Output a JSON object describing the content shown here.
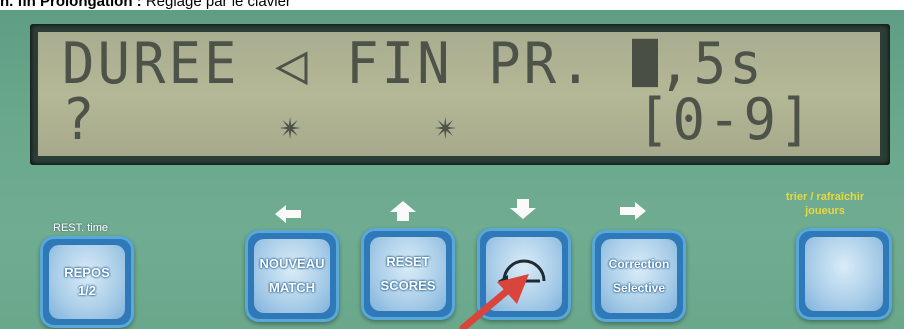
{
  "caption": {
    "bold": "n. fin Prolongation :",
    "rest": " Réglage par le clavier"
  },
  "lcd": {
    "line1": "DUREE ◁ FIN PR. ",
    "line1_suffix": ",5s",
    "line2_left": "?",
    "line2_mid": "       ✴     ✴    ",
    "line2_right": "[0-9]"
  },
  "buttons": {
    "repos": {
      "top_label": "REST. time",
      "line1": "REPOS",
      "line2": "1/2"
    },
    "nouveau": {
      "line1": "NOUVEAU",
      "line2": "MATCH"
    },
    "reset": {
      "line1": "RESET",
      "line2": "SCORES"
    },
    "enter": {
      "icon": "return-enter-icon"
    },
    "correction": {
      "line1": "Correction",
      "line2": "Selective"
    },
    "trier": {
      "top_label_1": "trier / rafraîchir",
      "top_label_2": "joueurs"
    }
  },
  "arrows": [
    "left-arrow-icon",
    "up-arrow-icon",
    "down-arrow-icon",
    "right-arrow-icon"
  ],
  "colors": {
    "panel": "#6aa88d",
    "lcd": "#b0b493",
    "button": "#2f79b8",
    "pointer": "#d9453b",
    "yellow_label": "#e7d840"
  }
}
